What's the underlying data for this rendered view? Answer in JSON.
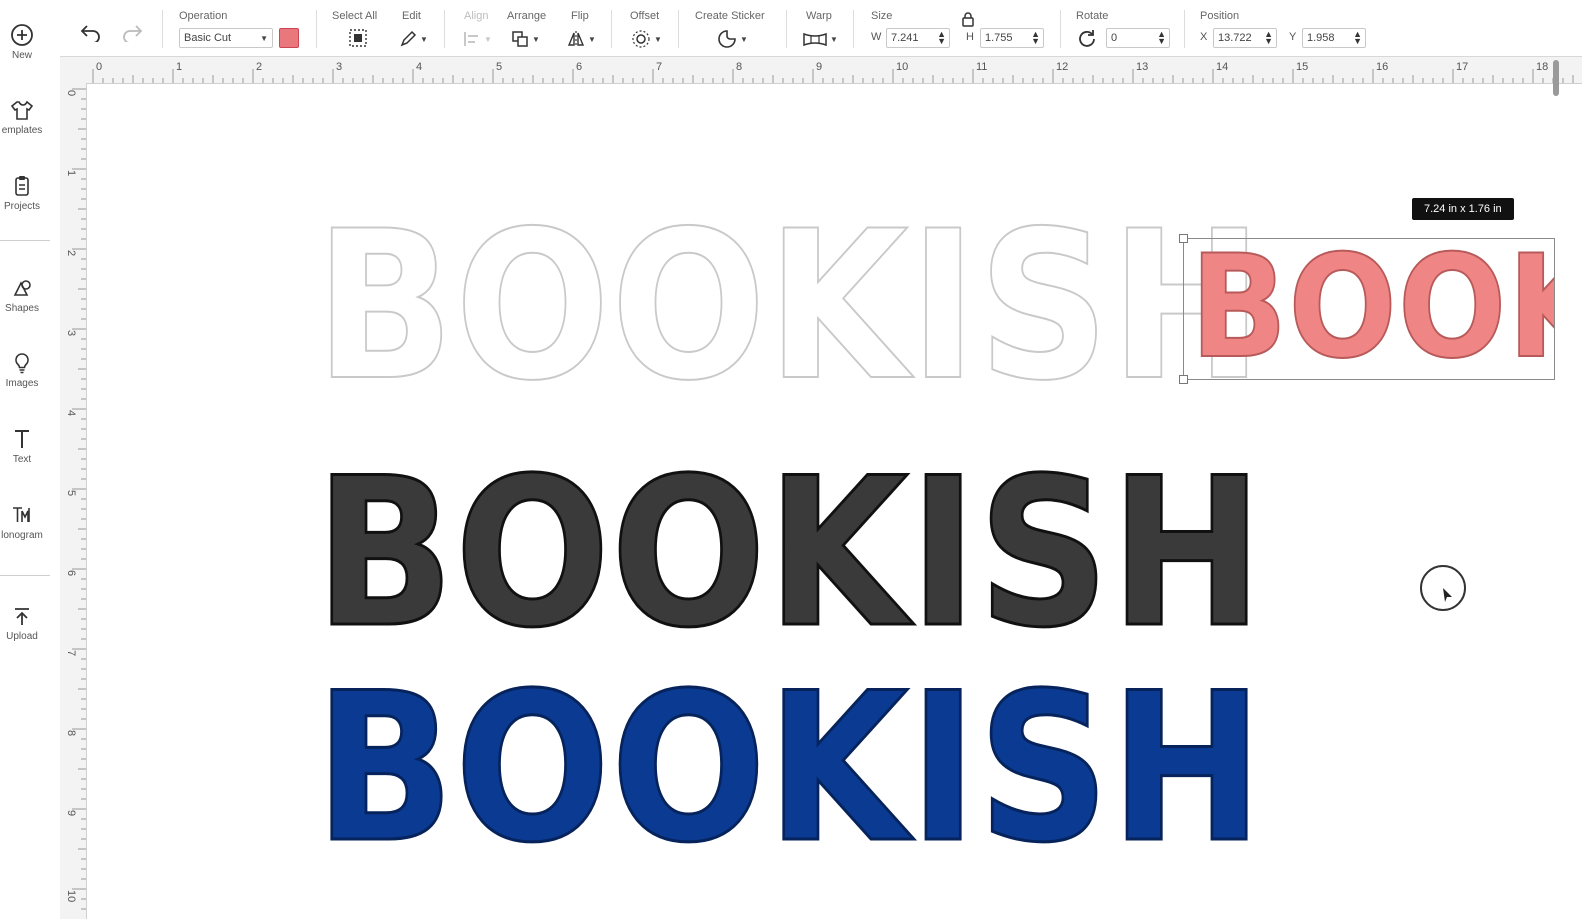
{
  "sidebar": {
    "items": [
      {
        "label": "New",
        "icon": "plus-circle-icon"
      },
      {
        "label": "emplates",
        "icon": "tshirt-icon"
      },
      {
        "label": "Projects",
        "icon": "clipboard-icon"
      },
      {
        "label": "Shapes",
        "icon": "shapes-icon"
      },
      {
        "label": "Images",
        "icon": "lightbulb-icon"
      },
      {
        "label": "Text",
        "icon": "text-icon"
      },
      {
        "label": "lonogram",
        "icon": "monogram-icon"
      },
      {
        "label": "Upload",
        "icon": "upload-icon"
      }
    ]
  },
  "toolbar": {
    "operation_label": "Operation",
    "operation_value": "Basic Cut",
    "operation_color": "#e8787c",
    "select_all_label": "Select All",
    "edit_label": "Edit",
    "align_label": "Align",
    "arrange_label": "Arrange",
    "flip_label": "Flip",
    "offset_label": "Offset",
    "create_sticker_label": "Create Sticker",
    "warp_label": "Warp",
    "size_label": "Size",
    "width_axis": "W",
    "width_value": "7.241",
    "height_axis": "H",
    "height_value": "1.755",
    "rotate_label": "Rotate",
    "rotate_value": "0",
    "position_label": "Position",
    "x_axis": "X",
    "x_value": "13.722",
    "y_axis": "Y",
    "y_value": "1.958"
  },
  "ruler": {
    "top": [
      "0",
      "1",
      "2",
      "3",
      "4",
      "5",
      "6",
      "7",
      "8",
      "9",
      "10",
      "11",
      "12",
      "13",
      "14",
      "15",
      "16",
      "17",
      "18"
    ],
    "left": [
      "0",
      "1",
      "2",
      "3",
      "4",
      "5",
      "6",
      "7",
      "8",
      "9",
      "10"
    ]
  },
  "canvas": {
    "outline_text": "BOOKISH",
    "black_text": "BOOKISH",
    "blue_text": "BOOKISH",
    "pink_text": "BOOKISH",
    "size_tooltip": "7.24  in x 1.76  in",
    "colors": {
      "outline_stroke": "#c9c9c9",
      "black_fill": "#3a3a3a",
      "blue_fill": "#0a3a91",
      "pink_fill": "#f08585"
    }
  }
}
